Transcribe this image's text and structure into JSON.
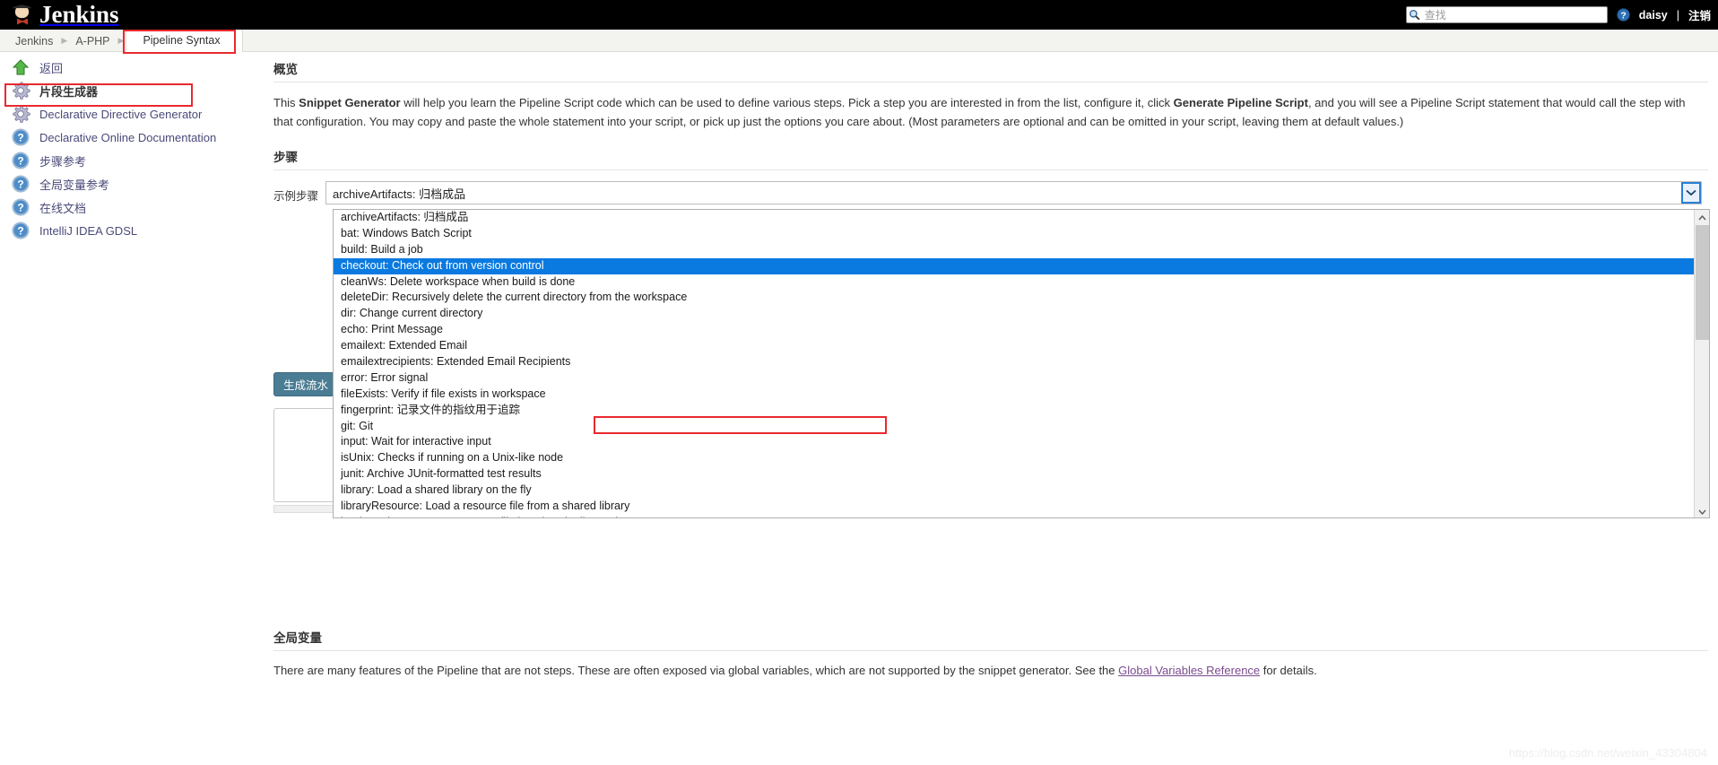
{
  "topbar": {
    "brand": "Jenkins",
    "search_placeholder": "查找",
    "search_value": "",
    "help_icon": "help-icon",
    "user": "daisy",
    "separator": "|",
    "logout": "注销"
  },
  "breadcrumbs": [
    {
      "label": "Jenkins",
      "active": false
    },
    {
      "label": "A-PHP",
      "active": false
    },
    {
      "label": "Pipeline Syntax",
      "active": true
    }
  ],
  "sidebar": {
    "items": [
      {
        "label": "返回",
        "icon": "up-arrow-icon",
        "bold": false
      },
      {
        "label": "片段生成器",
        "icon": "gear-icon",
        "bold": true
      },
      {
        "label": "Declarative Directive Generator",
        "icon": "gear-icon",
        "bold": false
      },
      {
        "label": "Declarative Online Documentation",
        "icon": "help-icon",
        "bold": false
      },
      {
        "label": "步骤参考",
        "icon": "help-icon",
        "bold": false
      },
      {
        "label": "全局变量参考",
        "icon": "help-icon",
        "bold": false
      },
      {
        "label": "在线文档",
        "icon": "help-icon",
        "bold": false
      },
      {
        "label": "IntelliJ IDEA GDSL",
        "icon": "help-icon",
        "bold": false
      }
    ]
  },
  "overview": {
    "title": "概览",
    "text_part1": "This ",
    "bold1": "Snippet Generator",
    "text_part2": " will help you learn the Pipeline Script code which can be used to define various steps. Pick a step you are interested in from the list, configure it, click ",
    "bold2": "Generate Pipeline Script",
    "text_part3": ", and you will see a Pipeline Script statement that would call the step with that configuration. You may copy and paste the whole statement into your script, or pick up just the options you care about. (Most parameters are optional and can be omitted in your script, leaving them at default values.)"
  },
  "steps": {
    "title": "步骤",
    "sample_label": "示例步骤",
    "selected_value": "archiveArtifacts: 归档成品",
    "dropdown_arrow_icon": "chevron-down-icon",
    "generate_button": "生成流水",
    "options": [
      "archiveArtifacts: 归档成品",
      "bat: Windows Batch Script",
      "build: Build a job",
      "checkout: Check out from version control",
      "cleanWs: Delete workspace when build is done",
      "deleteDir: Recursively delete the current directory from the workspace",
      "dir: Change current directory",
      "echo: Print Message",
      "emailext: Extended Email",
      "emailextrecipients: Extended Email Recipients",
      "error: Error signal",
      "fileExists: Verify if file exists in workspace",
      "fingerprint: 记录文件的指纹用于追踪",
      "git: Git",
      "input: Wait for interactive input",
      "isUnix: Checks if running on a Unix-like node",
      "junit: Archive JUnit-formatted test results",
      "library: Load a shared library on the fly",
      "libraryResource: Load a resource file from a shared library",
      "load: Evaluate a Groovy source file into the Pipeline script"
    ],
    "selected_index": 3
  },
  "globals": {
    "title": "全局变量",
    "text_part1": "There are many features of the Pipeline that are not steps. These are often exposed via global variables, which are not supported by the snippet generator. See the ",
    "link": "Global Variables Reference",
    "text_part2": " for details."
  },
  "watermark": "https://blog.csdn.net/weixin_43304804",
  "colors": {
    "topbar_bg": "#000000",
    "breadcrumb_bg": "#f3f3f0",
    "highlight_red": "#e8292f",
    "selection_blue": "#0a7ae0",
    "button_bg": "#4a7c94",
    "link_purple": "#4a4a7a"
  }
}
